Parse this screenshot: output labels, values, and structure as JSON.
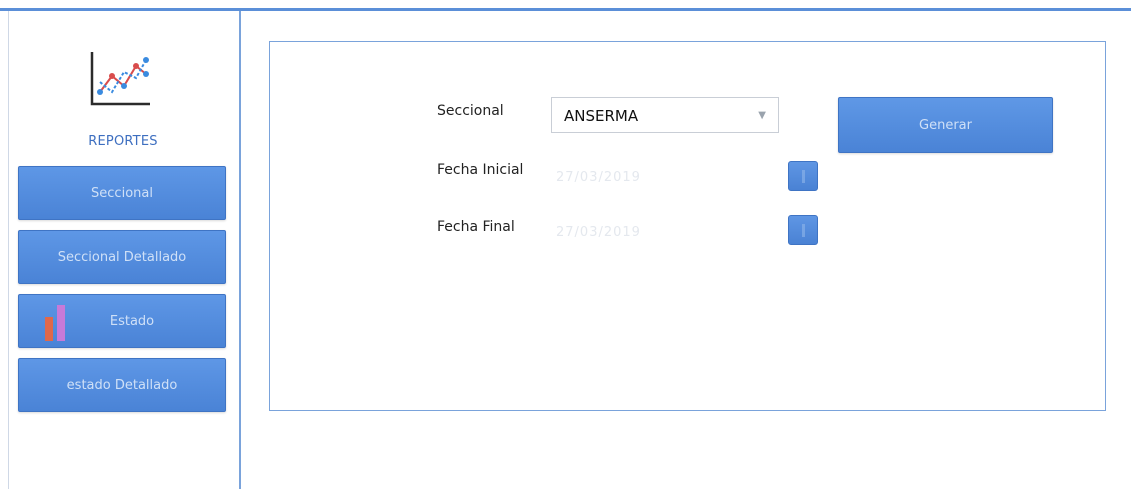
{
  "sidebar": {
    "title": "REPORTES",
    "logo_icon": "line-chart-icon",
    "items": [
      {
        "label": "Seccional"
      },
      {
        "label": "Seccional Detallado"
      },
      {
        "label": "Estado",
        "icon": "bar-chart-icon"
      },
      {
        "label": "estado Detallado"
      }
    ]
  },
  "form": {
    "seccional_label": "Seccional",
    "seccional_value": "ANSERMA",
    "fecha_inicial_label": "Fecha Inicial",
    "fecha_inicial_value": "27/03/2019",
    "fecha_final_label": "Fecha Final",
    "fecha_final_value": "27/03/2019",
    "generate_label": "Generar"
  },
  "colors": {
    "accent": "#4a83d6",
    "border": "#7aa3db",
    "title": "#3e6fc0"
  }
}
